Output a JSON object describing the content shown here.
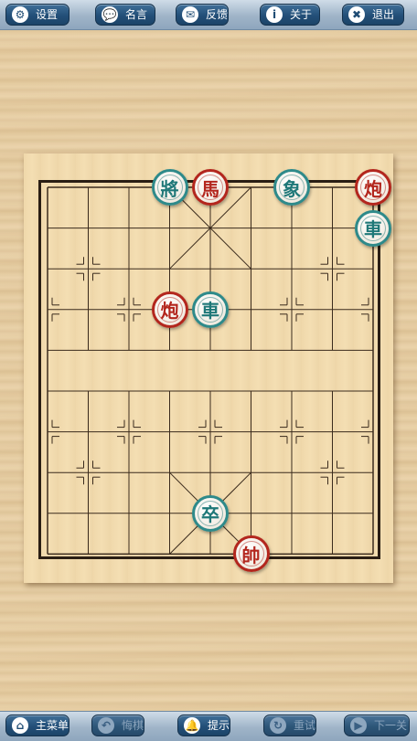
{
  "toolbar_top": [
    {
      "name": "settings-button",
      "icon": "gear-icon",
      "glyph": "⚙",
      "label": "设置",
      "disabled": false
    },
    {
      "name": "quotes-button",
      "icon": "speech-bubble-icon",
      "glyph": "💬",
      "label": "名言",
      "disabled": false
    },
    {
      "name": "feedback-button",
      "icon": "envelope-icon",
      "glyph": "✉",
      "label": "反馈",
      "disabled": false
    },
    {
      "name": "about-button",
      "icon": "info-icon",
      "glyph": "i",
      "label": "关于",
      "disabled": false
    },
    {
      "name": "exit-button",
      "icon": "close-icon",
      "glyph": "✖",
      "label": "退出",
      "disabled": false
    }
  ],
  "toolbar_bottom": [
    {
      "name": "main-menu-button",
      "icon": "home-icon",
      "glyph": "⌂",
      "label": "主菜单",
      "disabled": false
    },
    {
      "name": "undo-button",
      "icon": "undo-icon",
      "glyph": "↶",
      "label": "悔棋",
      "disabled": true
    },
    {
      "name": "hint-button",
      "icon": "bell-icon",
      "glyph": "🔔",
      "label": "提示",
      "disabled": false
    },
    {
      "name": "retry-button",
      "icon": "retry-icon",
      "glyph": "↻",
      "label": "重试",
      "disabled": true
    },
    {
      "name": "next-level-button",
      "icon": "next-icon",
      "glyph": "▶",
      "label": "下一关",
      "disabled": true
    }
  ],
  "board": {
    "columns": 9,
    "rows": 10,
    "pieces": [
      {
        "char": "將",
        "side": "teal",
        "col": 3,
        "row": 0
      },
      {
        "char": "馬",
        "side": "red",
        "col": 4,
        "row": 0
      },
      {
        "char": "象",
        "side": "teal",
        "col": 6,
        "row": 0
      },
      {
        "char": "炮",
        "side": "red",
        "col": 8,
        "row": 0
      },
      {
        "char": "車",
        "side": "teal",
        "col": 8,
        "row": 1
      },
      {
        "char": "炮",
        "side": "red",
        "col": 3,
        "row": 3
      },
      {
        "char": "車",
        "side": "teal",
        "col": 4,
        "row": 3
      },
      {
        "char": "卒",
        "side": "teal",
        "col": 4,
        "row": 8
      },
      {
        "char": "帥",
        "side": "red",
        "col": 5,
        "row": 9
      }
    ]
  }
}
